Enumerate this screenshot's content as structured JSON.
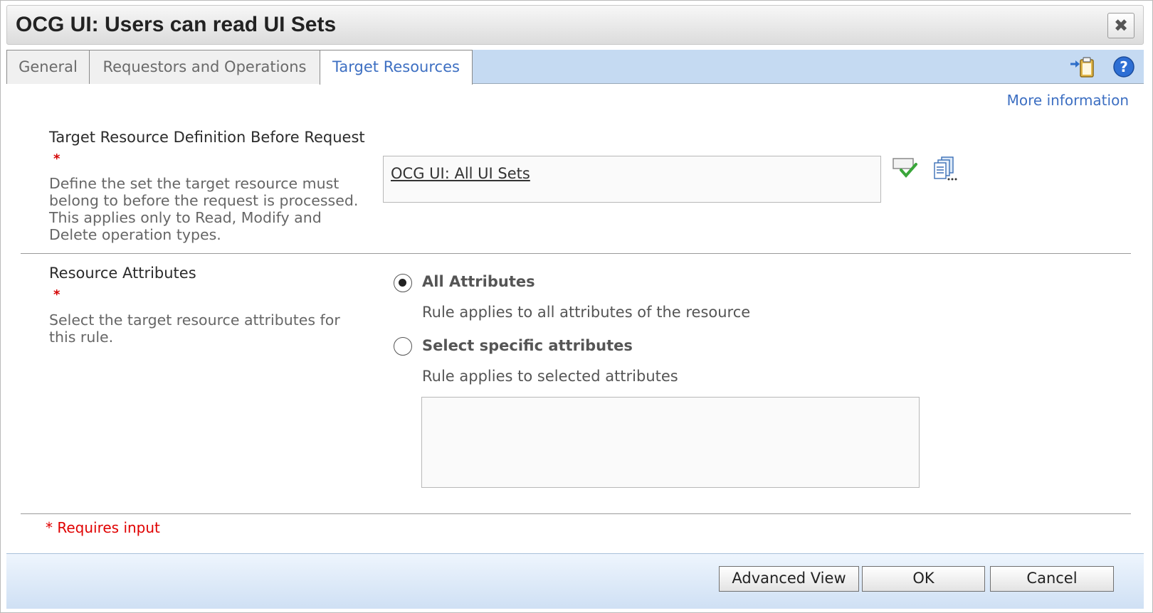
{
  "dialog": {
    "title": "OCG UI: Users can read UI Sets",
    "close_label": "✖"
  },
  "tabs": [
    {
      "label": "General",
      "active": false
    },
    {
      "label": "Requestors and Operations",
      "active": false
    },
    {
      "label": "Target Resources",
      "active": true
    }
  ],
  "toolbar": {
    "icons": [
      "paste-to-clipboard-icon",
      "help-icon"
    ]
  },
  "more_info": "More information",
  "target_definition": {
    "label": "Target Resource Definition Before Request",
    "required": "*",
    "description": "Define the set the target resource must belong to before the request is processed. This applies only to Read, Modify and Delete operation types.",
    "value": "OCG UI: All UI Sets",
    "icons": [
      "validate-icon",
      "browse-icon"
    ]
  },
  "resource_attributes": {
    "label": "Resource Attributes",
    "required": "*",
    "description": "Select the target resource attributes for this rule.",
    "options": [
      {
        "label": "All Attributes",
        "description": "Rule applies to all attributes of the resource",
        "checked": true
      },
      {
        "label": "Select specific attributes",
        "description": "Rule applies to selected attributes",
        "checked": false
      }
    ]
  },
  "requires_input": "* Requires input",
  "footer": {
    "advanced_label": "Advanced View",
    "ok_label": "OK",
    "cancel_label": "Cancel"
  },
  "colors": {
    "tab_strip": "#c5daf2",
    "active_tab_text": "#3d6fc2",
    "required": "#e00000"
  }
}
